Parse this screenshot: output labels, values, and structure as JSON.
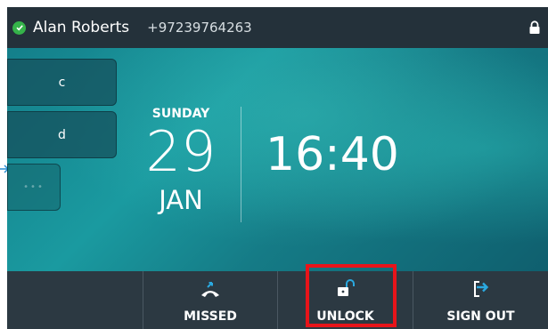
{
  "status_bar": {
    "user_name": "Alan Roberts",
    "phone_number": "+97239764263",
    "presence_icon": "check-circle-icon",
    "presence_color": "#35b34a",
    "lock_icon": "padlock-icon"
  },
  "line_keys": [
    {
      "label": "c"
    },
    {
      "label": "d"
    },
    {
      "label": "•••"
    }
  ],
  "home": {
    "weekday": "SUNDAY",
    "day": "29",
    "month": "JAN",
    "time": "16:40"
  },
  "soft_keys": [
    {
      "label": "MISSED",
      "icon": "missed-call-icon"
    },
    {
      "label": "UNLOCK",
      "icon": "unlock-icon"
    },
    {
      "label": "SIGN OUT",
      "icon": "sign-out-icon"
    }
  ],
  "colors": {
    "accent_icon": "#2aa9e0",
    "highlight": "#e8141a",
    "background_teal": "#1a9aa0"
  }
}
